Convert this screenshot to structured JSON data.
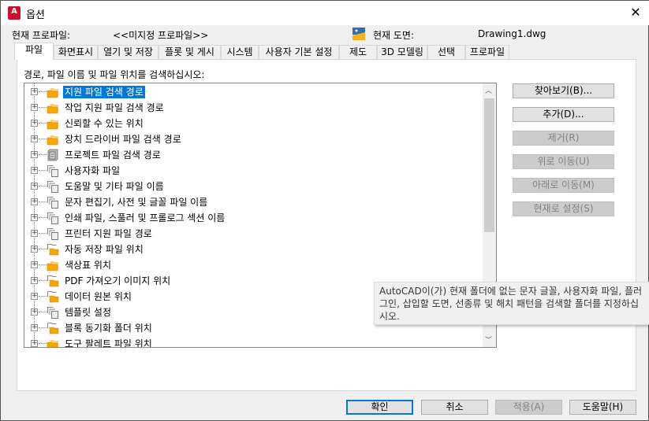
{
  "window": {
    "title": "옵션",
    "app_icon_letter": "A",
    "close": "✕"
  },
  "profile": {
    "label": "현재 프로파일:",
    "value": "<<미지정 프로파일>>"
  },
  "drawing": {
    "label": "현재 도면:",
    "value": "Drawing1.dwg"
  },
  "tabs": [
    "파일",
    "화면표시",
    "열기 및 저장",
    "플롯 및 게시",
    "시스템",
    "사용자 기본 설정",
    "제도",
    "3D 모델링",
    "선택",
    "프로파일"
  ],
  "active_tab": "파일",
  "tree_label": "경로, 파일 이름 및 파일 위치를 검색하십시오:",
  "tree": [
    {
      "label": "지원 파일 검색 경로",
      "icon": "folder",
      "selected": true
    },
    {
      "label": "작업 지원 파일 검색 경로",
      "icon": "folder"
    },
    {
      "label": "신뢰할 수 있는 위치",
      "icon": "folder"
    },
    {
      "label": "장치 드라이버 파일 검색 경로",
      "icon": "folder"
    },
    {
      "label": "프로젝트 파일 검색 경로",
      "icon": "project"
    },
    {
      "label": "사용자화 파일",
      "icon": "files"
    },
    {
      "label": "도움말 및 기타 파일 이름",
      "icon": "files"
    },
    {
      "label": "문자 편집기, 사전 및 글꼴 파일 이름",
      "icon": "files"
    },
    {
      "label": "인쇄 파일, 스풀러 및 프롤로그 섹션 이름",
      "icon": "files"
    },
    {
      "label": "프린터 지원 파일 경로",
      "icon": "files"
    },
    {
      "label": "자동 저장 파일 위치",
      "icon": "folder-outline"
    },
    {
      "label": "색상표 위치",
      "icon": "folder"
    },
    {
      "label": "PDF 가져오기 이미지 위치",
      "icon": "folder-outline"
    },
    {
      "label": "데이터 원본 위치",
      "icon": "folder-outline"
    },
    {
      "label": "템플릿 설정",
      "icon": "files"
    },
    {
      "label": "블록 동기화 폴더 위치",
      "icon": "folder-outline"
    },
    {
      "label": "도구 팔레트 파일 위치",
      "icon": "folder"
    }
  ],
  "side_buttons": [
    {
      "label": "찾아보기(B)...",
      "enabled": true
    },
    {
      "label": "추가(D)...",
      "enabled": true
    },
    {
      "label": "제거(R)",
      "enabled": false
    },
    {
      "label": "위로 이동(U)",
      "enabled": false
    },
    {
      "label": "아래로 이동(M)",
      "enabled": false
    },
    {
      "label": "현재로 설정(S)",
      "enabled": false
    }
  ],
  "tooltip": "AutoCAD이(가) 현재 폴더에 없는 문자 글꼴, 사용자화 파일, 플러그인, 삽입할 도면, 선종류 및 해치 패턴을 검색할 폴더를 지정하십시오.",
  "footer": {
    "ok": "확인",
    "cancel": "취소",
    "apply": "적용(A)",
    "help": "도움말(H)",
    "apply_enabled": false
  },
  "colors": {
    "selection": "#0078d7",
    "folder": "#f7a600",
    "app_icon": "#c8102e"
  }
}
